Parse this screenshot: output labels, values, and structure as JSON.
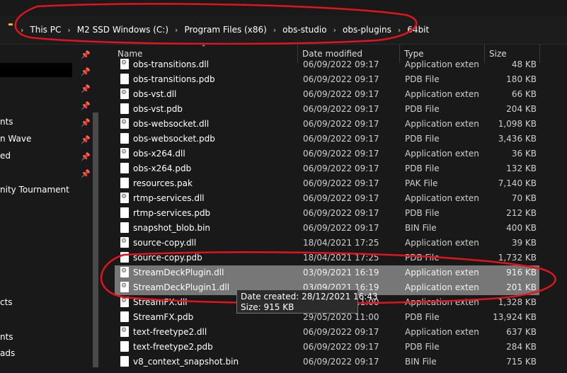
{
  "breadcrumb": [
    "This PC",
    "M2 SSD Windows (C:)",
    "Program Files (x86)",
    "obs-studio",
    "obs-plugins",
    "64bit"
  ],
  "nav_items": [
    "nts",
    "n Wave",
    "ed",
    "nity Tournament",
    "cts",
    "nts",
    "ads"
  ],
  "columns": {
    "name": "Name",
    "date": "Date modified",
    "type": "Type",
    "size": "Size"
  },
  "files": [
    {
      "name": "obs-transitions.dll",
      "date": "06/09/2022 09:17",
      "type": "Application exten...",
      "size": "48 KB",
      "kind": "dll"
    },
    {
      "name": "obs-transitions.pdb",
      "date": "06/09/2022 09:17",
      "type": "PDB File",
      "size": "180 KB",
      "kind": "file"
    },
    {
      "name": "obs-vst.dll",
      "date": "06/09/2022 09:17",
      "type": "Application exten...",
      "size": "66 KB",
      "kind": "dll"
    },
    {
      "name": "obs-vst.pdb",
      "date": "06/09/2022 09:17",
      "type": "PDB File",
      "size": "204 KB",
      "kind": "file"
    },
    {
      "name": "obs-websocket.dll",
      "date": "06/09/2022 09:17",
      "type": "Application exten...",
      "size": "1,098 KB",
      "kind": "dll"
    },
    {
      "name": "obs-websocket.pdb",
      "date": "06/09/2022 09:17",
      "type": "PDB File",
      "size": "3,436 KB",
      "kind": "file"
    },
    {
      "name": "obs-x264.dll",
      "date": "06/09/2022 09:17",
      "type": "Application exten...",
      "size": "36 KB",
      "kind": "dll"
    },
    {
      "name": "obs-x264.pdb",
      "date": "06/09/2022 09:17",
      "type": "PDB File",
      "size": "132 KB",
      "kind": "file"
    },
    {
      "name": "resources.pak",
      "date": "06/09/2022 09:17",
      "type": "PAK File",
      "size": "7,140 KB",
      "kind": "file"
    },
    {
      "name": "rtmp-services.dll",
      "date": "06/09/2022 09:17",
      "type": "Application exten...",
      "size": "70 KB",
      "kind": "dll"
    },
    {
      "name": "rtmp-services.pdb",
      "date": "06/09/2022 09:17",
      "type": "PDB File",
      "size": "212 KB",
      "kind": "file"
    },
    {
      "name": "snapshot_blob.bin",
      "date": "06/09/2022 09:17",
      "type": "BIN File",
      "size": "400 KB",
      "kind": "file"
    },
    {
      "name": "source-copy.dll",
      "date": "18/04/2021 17:25",
      "type": "Application exten...",
      "size": "39 KB",
      "kind": "dll"
    },
    {
      "name": "source-copy.pdb",
      "date": "18/04/2021 17:25",
      "type": "PDB File",
      "size": "1,732 KB",
      "kind": "file"
    },
    {
      "name": "StreamDeckPlugin.dll",
      "date": "03/09/2021 16:19",
      "type": "Application exten...",
      "size": "916 KB",
      "kind": "dll",
      "selected": true
    },
    {
      "name": "StreamDeckPlugin1.dll",
      "date": "03/09/2021 16:19",
      "type": "Application exten...",
      "size": "201 KB",
      "kind": "dll",
      "selected": true
    },
    {
      "name": "StreamFX.dll",
      "date": "29/05/2020 11:00",
      "type": "Application exten...",
      "size": "1,328 KB",
      "kind": "dll"
    },
    {
      "name": "StreamFX.pdb",
      "date": "29/05/2020 11:00",
      "type": "PDB File",
      "size": "13,924 KB",
      "kind": "file"
    },
    {
      "name": "text-freetype2.dll",
      "date": "06/09/2022 09:17",
      "type": "Application exten...",
      "size": "637 KB",
      "kind": "dll"
    },
    {
      "name": "text-freetype2.pdb",
      "date": "06/09/2022 09:17",
      "type": "PDB File",
      "size": "284 KB",
      "kind": "file"
    },
    {
      "name": "v8_context_snapshot.bin",
      "date": "06/09/2022 09:17",
      "type": "BIN File",
      "size": "715 KB",
      "kind": "file"
    }
  ],
  "tooltip": {
    "line1": "Date created: 28/12/2021 16:43",
    "line2": "Size: 915 KB"
  },
  "colors": {
    "accent_annotation": "#e0141e",
    "selection": "#777777",
    "folder": "#e8b93a"
  }
}
